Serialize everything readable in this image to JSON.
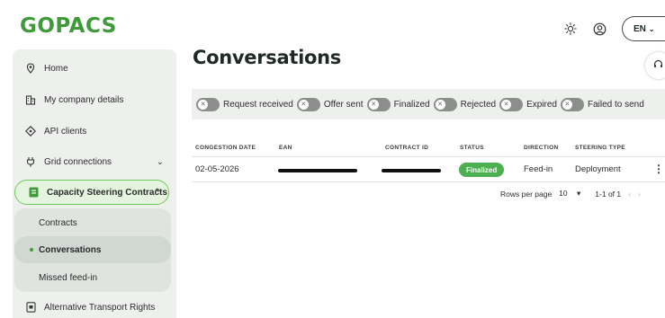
{
  "brand": {
    "logo": "GOPACS",
    "color": "#3f9b3a"
  },
  "topbar": {
    "theme_icon": "sun-icon",
    "account_icon": "user-circle-icon",
    "language": "EN",
    "language_icon": "chevron-down-icon"
  },
  "sidebar": {
    "items": [
      {
        "label": "Home",
        "icon": "location-pin-icon"
      },
      {
        "label": "My company details",
        "icon": "building-icon"
      },
      {
        "label": "API clients",
        "icon": "api-icon"
      },
      {
        "label": "Grid connections",
        "icon": "plug-icon",
        "expandable": true
      },
      {
        "label": "Capacity Steering Contracts",
        "icon": "contract-icon",
        "expanded": true,
        "active": true
      },
      {
        "label": "Alternative Transport Rights",
        "icon": "document-icon"
      }
    ],
    "subitems": [
      {
        "label": "Contracts"
      },
      {
        "label": "Conversations",
        "active": true
      },
      {
        "label": "Missed feed-in"
      }
    ]
  },
  "page": {
    "title": "Conversations",
    "help_icon": "headset-icon"
  },
  "filters": [
    {
      "label": "Request received",
      "enabled": false
    },
    {
      "label": "Offer sent",
      "enabled": false
    },
    {
      "label": "Finalized",
      "enabled": false
    },
    {
      "label": "Rejected",
      "enabled": false
    },
    {
      "label": "Expired",
      "enabled": false
    },
    {
      "label": "Failed to send",
      "enabled": false
    }
  ],
  "table": {
    "columns": [
      "CONGESTION DATE",
      "EAN",
      "CONTRACT ID",
      "STATUS",
      "DIRECTION",
      "STEERING TYPE"
    ],
    "rows": [
      {
        "congestion_date": "02-05-2026",
        "ean": "[redacted]",
        "contract_id": "[redacted]",
        "status": "Finalized",
        "direction": "Feed-in",
        "steering_type": "Deployment"
      }
    ],
    "status_color": "#4caf50"
  },
  "pagination": {
    "rows_per_page_label": "Rows per page",
    "rows_per_page_value": "10",
    "range": "1-1 of 1"
  }
}
